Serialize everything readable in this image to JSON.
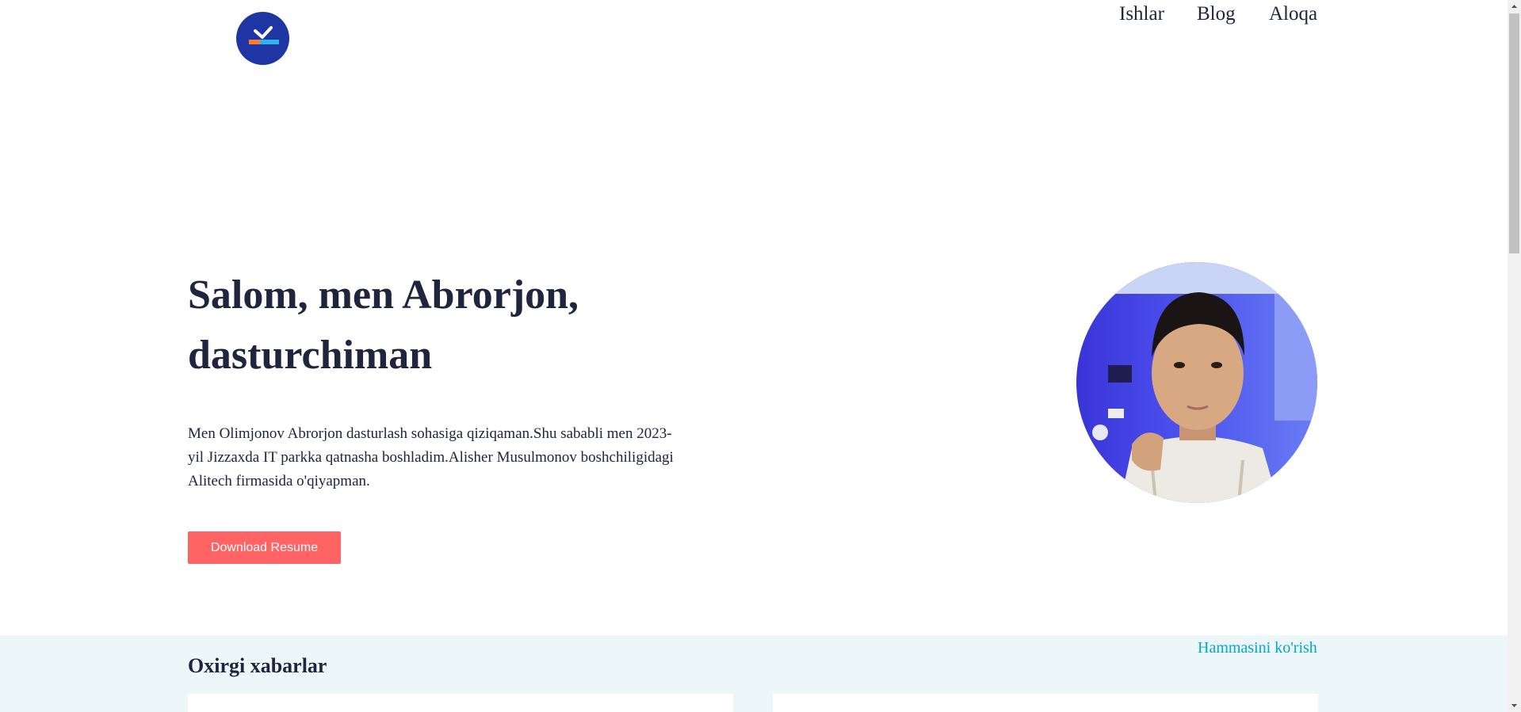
{
  "header": {
    "nav": [
      {
        "label": "Ishlar"
      },
      {
        "label": "Blog"
      },
      {
        "label": "Aloqa"
      }
    ]
  },
  "hero": {
    "title": "Salom, men Abrorjon, dasturchiman",
    "description": "Men Olimjonov Abrorjon dasturlash sohasiga qiziqaman.Shu sababli men 2023-yil Jizzaxda IT parkka qatnasha boshladim.Alisher Musulmonov boshchiligidagi Alitech firmasida o'qiyapman.",
    "button_label": "Download Resume"
  },
  "news": {
    "title": "Oxirgi xabarlar",
    "see_all": "Hammasini ko'rish"
  },
  "colors": {
    "text": "#21243D",
    "accent_button": "#FF6464",
    "link": "#00A8CC",
    "band_bg": "#EDF7FA",
    "logo_bg": "#1E35A3"
  },
  "icons": {
    "logo": "brand-logo-icon",
    "avatar": "profile-photo"
  }
}
